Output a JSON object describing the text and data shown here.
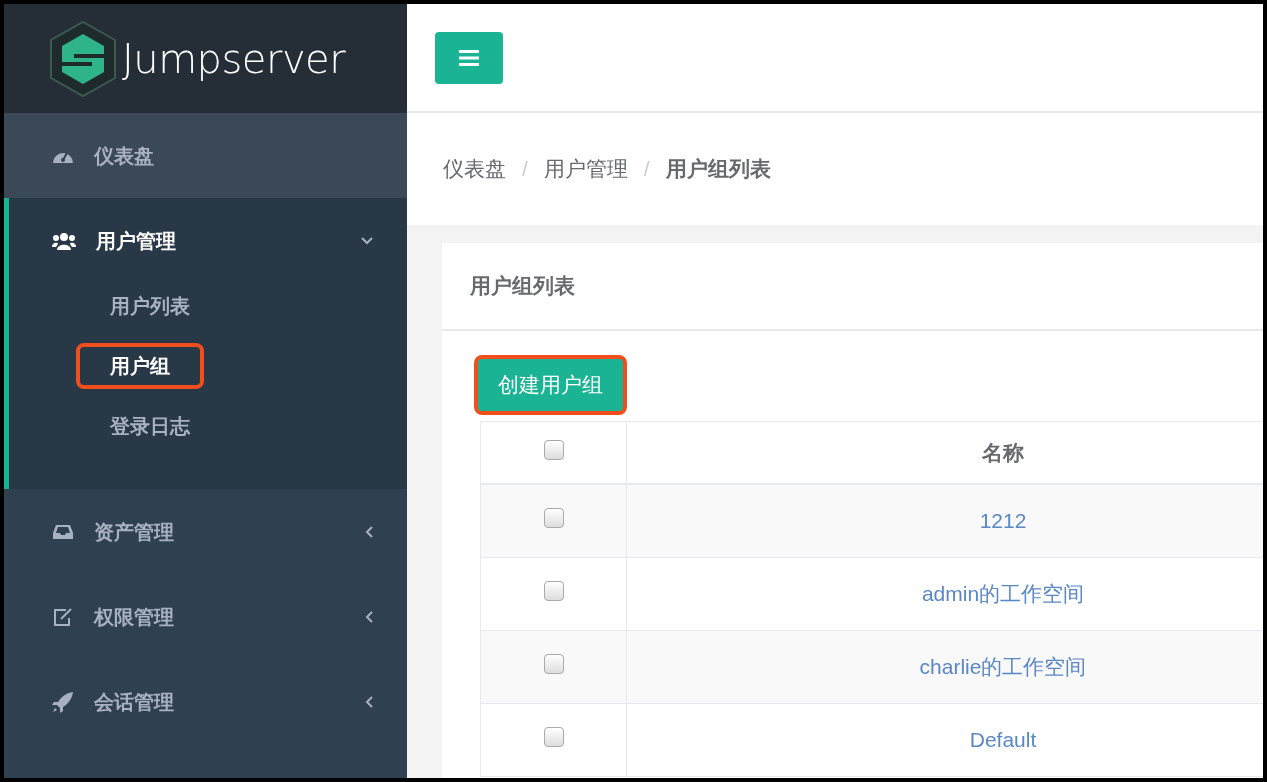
{
  "brand": "Jumpserver",
  "sidebar": {
    "items": [
      {
        "label": "仪表盘",
        "kind": "link"
      },
      {
        "label": "用户管理",
        "kind": "group",
        "expanded": true,
        "children": [
          {
            "label": "用户列表",
            "selected": false,
            "annotated": false
          },
          {
            "label": "用户组",
            "selected": true,
            "annotated": true
          },
          {
            "label": "登录日志",
            "selected": false,
            "annotated": false
          }
        ]
      },
      {
        "label": "资产管理",
        "kind": "group",
        "expanded": false
      },
      {
        "label": "权限管理",
        "kind": "group",
        "expanded": false
      },
      {
        "label": "会话管理",
        "kind": "group",
        "expanded": false
      }
    ]
  },
  "breadcrumb": {
    "items": [
      "仪表盘",
      "用户管理",
      "用户组列表"
    ],
    "separators": [
      "/",
      "/"
    ]
  },
  "panel": {
    "title": "用户组列表",
    "create_button": {
      "label": "创建用户组",
      "annotated": true
    },
    "table": {
      "columns": [
        "名称"
      ],
      "header_checked": false,
      "rows": [
        {
          "name": "1212",
          "checked": false
        },
        {
          "name": "admin的工作空间",
          "checked": false
        },
        {
          "name": "charlie的工作空间",
          "checked": false
        },
        {
          "name": "Default",
          "checked": false
        }
      ]
    }
  }
}
